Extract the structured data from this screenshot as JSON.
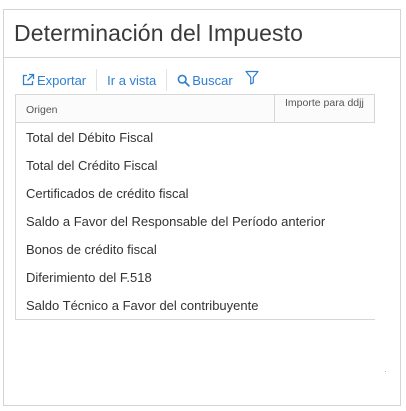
{
  "panel": {
    "title": "Determinación del Impuesto"
  },
  "toolbar": {
    "export_label": "Exportar",
    "export_icon": "external-link-icon",
    "goto_label": "Ir a vista",
    "search_label": "Buscar",
    "search_icon": "search-icon",
    "filter_icon": "filter-icon",
    "accent_color": "#2f7fd1"
  },
  "grid": {
    "columns": [
      "Origen",
      "Importe para ddjj"
    ],
    "rows": [
      {
        "origen": "Total del Débito Fiscal",
        "importe": ""
      },
      {
        "origen": "Total del Crédito Fiscal",
        "importe": ""
      },
      {
        "origen": "Certificados de crédito fiscal",
        "importe": ""
      },
      {
        "origen": "Saldo a Favor del Responsable del Período anterior",
        "importe": ""
      },
      {
        "origen": "Bonos de crédito fiscal",
        "importe": ""
      },
      {
        "origen": "Diferimiento del F.518",
        "importe": ""
      },
      {
        "origen": "Saldo Técnico a Favor del contribuyente",
        "importe": ""
      }
    ]
  }
}
